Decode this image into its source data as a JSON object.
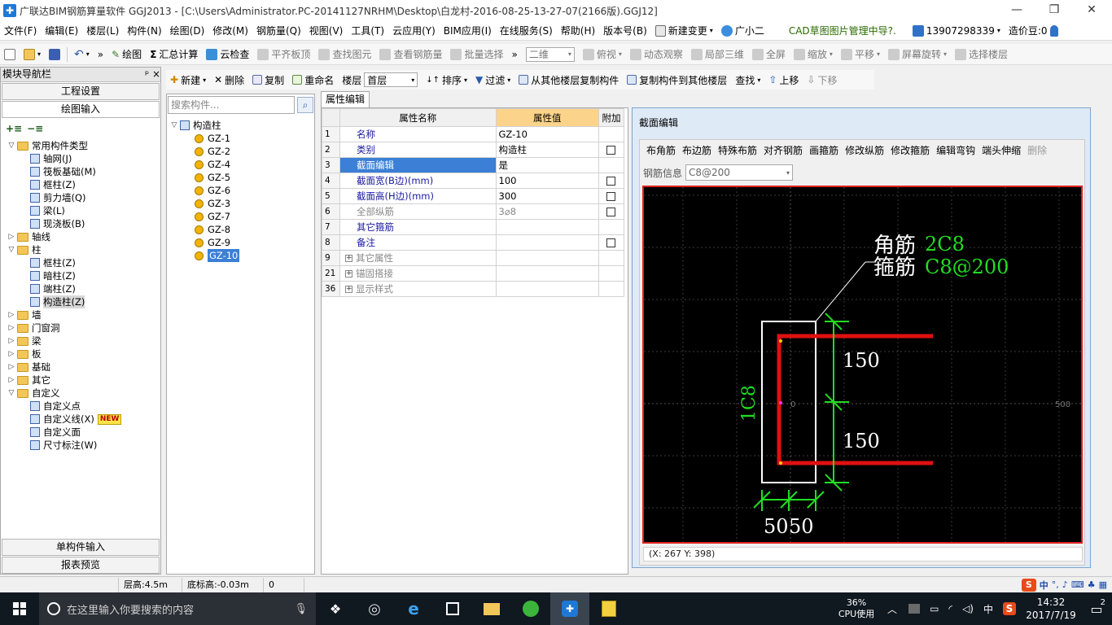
{
  "title": "广联达BIM钢筋算量软件 GGJ2013 - [C:\\Users\\Administrator.PC-20141127NRHM\\Desktop\\白龙村-2016-08-25-13-27-07(2166版).GGJ12]",
  "menu": [
    "文件(F)",
    "编辑(E)",
    "楼层(L)",
    "构件(N)",
    "绘图(D)",
    "修改(M)",
    "钢筋量(Q)",
    "视图(V)",
    "工具(T)",
    "云应用(Y)",
    "BIM应用(I)",
    "在线服务(S)",
    "帮助(H)",
    "版本号(B)"
  ],
  "menu_extra": {
    "new_change": "新建变更",
    "assistant": "广小二",
    "cad_manage": "CAD草图图片管理中导?.",
    "phone": "13907298339",
    "price_bean": "造价豆:0"
  },
  "toolbar1": {
    "draw": "绘图",
    "summary": "汇总计算",
    "cloud_check": "云检查",
    "align_slab": "平齐板顶",
    "find_element": "查找图元",
    "view_rebar": "查看钢筋量",
    "batch_select": "批量选择",
    "view_mode": "二维",
    "top_view": "俯视",
    "dynamic": "动态观察",
    "local_3d": "局部三维",
    "fullscreen": "全屏",
    "zoom": "缩放",
    "pan": "平移",
    "screen_rotate": "屏幕旋转",
    "select_floor": "选择楼层"
  },
  "nav": {
    "title": "模块导航栏",
    "pin": "ᵖ ×",
    "btn_project": "工程设置",
    "btn_draw": "绘图输入",
    "btn_single": "单构件输入",
    "btn_report": "报表预览",
    "tree": [
      {
        "level": 0,
        "exp": "▽",
        "type": "folder",
        "label": "常用构件类型"
      },
      {
        "level": 1,
        "type": "grid",
        "label": "轴网(J)"
      },
      {
        "level": 1,
        "type": "grid",
        "label": "筏板基础(M)"
      },
      {
        "level": 1,
        "type": "grid",
        "label": "框柱(Z)"
      },
      {
        "level": 1,
        "type": "grid",
        "label": "剪力墙(Q)"
      },
      {
        "level": 1,
        "type": "grid",
        "label": "梁(L)"
      },
      {
        "level": 1,
        "type": "grid",
        "label": "现浇板(B)"
      },
      {
        "level": 0,
        "exp": "▷",
        "type": "folder",
        "label": "轴线"
      },
      {
        "level": 0,
        "exp": "▽",
        "type": "folder",
        "label": "柱"
      },
      {
        "level": 1,
        "type": "grid",
        "label": "框柱(Z)"
      },
      {
        "level": 1,
        "type": "grid",
        "label": "暗柱(Z)"
      },
      {
        "level": 1,
        "type": "grid",
        "label": "端柱(Z)"
      },
      {
        "level": 1,
        "type": "grid",
        "label": "构造柱(Z)",
        "sel": true
      },
      {
        "level": 0,
        "exp": "▷",
        "type": "folder",
        "label": "墙"
      },
      {
        "level": 0,
        "exp": "▷",
        "type": "folder",
        "label": "门窗洞"
      },
      {
        "level": 0,
        "exp": "▷",
        "type": "folder",
        "label": "梁"
      },
      {
        "level": 0,
        "exp": "▷",
        "type": "folder",
        "label": "板"
      },
      {
        "level": 0,
        "exp": "▷",
        "type": "folder",
        "label": "基础"
      },
      {
        "level": 0,
        "exp": "▷",
        "type": "folder",
        "label": "其它"
      },
      {
        "level": 0,
        "exp": "▽",
        "type": "folder",
        "label": "自定义"
      },
      {
        "level": 1,
        "type": "grid",
        "label": "自定义点"
      },
      {
        "level": 1,
        "type": "grid",
        "label": "自定义线(X)",
        "badge": "NEW"
      },
      {
        "level": 1,
        "type": "grid",
        "label": "自定义面"
      },
      {
        "level": 1,
        "type": "grid",
        "label": "尺寸标注(W)"
      }
    ]
  },
  "toolbar2": {
    "new": "新建",
    "delete": "删除",
    "copy": "复制",
    "rename": "重命名",
    "floor_label": "楼层",
    "floor_value": "首层",
    "sort": "排序",
    "filter": "过滤",
    "copy_from": "从其他楼层复制构件",
    "copy_to": "复制构件到其他楼层",
    "find": "查找",
    "move_up": "上移",
    "move_down": "下移"
  },
  "components": {
    "search_placeholder": "搜索构件...",
    "root": "构造柱",
    "items": [
      "GZ-1",
      "GZ-2",
      "GZ-4",
      "GZ-5",
      "GZ-6",
      "GZ-3",
      "GZ-7",
      "GZ-8",
      "GZ-9",
      "GZ-10"
    ],
    "selected": "GZ-10"
  },
  "props": {
    "tab": "属性编辑",
    "col_name": "属性名称",
    "col_value": "属性值",
    "col_extra": "附加",
    "rows": [
      {
        "no": "1",
        "name": "名称",
        "value": "GZ-10",
        "chk": false,
        "cls": ""
      },
      {
        "no": "2",
        "name": "类别",
        "value": "构造柱",
        "chk": true,
        "cls": ""
      },
      {
        "no": "3",
        "name": "截面编辑",
        "value": "是",
        "chk": false,
        "cls": "selrow"
      },
      {
        "no": "4",
        "name": "截面宽(B边)(mm)",
        "value": "100",
        "chk": true,
        "cls": ""
      },
      {
        "no": "5",
        "name": "截面高(H边)(mm)",
        "value": "300",
        "chk": true,
        "cls": ""
      },
      {
        "no": "6",
        "name": "全部纵筋",
        "value": "3⌀8",
        "chk": true,
        "cls": "gray"
      },
      {
        "no": "7",
        "name": "其它箍筋",
        "value": "",
        "chk": false,
        "cls": ""
      },
      {
        "no": "8",
        "name": "备注",
        "value": "",
        "chk": true,
        "cls": ""
      },
      {
        "no": "9",
        "name": "其它属性",
        "value": "",
        "chk": false,
        "cls": "gray",
        "plus": true
      },
      {
        "no": "21",
        "name": "锚固搭接",
        "value": "",
        "chk": false,
        "cls": "gray",
        "plus": true
      },
      {
        "no": "36",
        "name": "显示样式",
        "value": "",
        "chk": false,
        "cls": "gray",
        "plus": true
      }
    ]
  },
  "section": {
    "title": "截面编辑",
    "tools": [
      "布角筋",
      "布边筋",
      "特殊布筋",
      "对齐钢筋",
      "画箍筋",
      "修改纵筋",
      "修改箍筋",
      "编辑弯钩",
      "端头伸缩",
      "删除"
    ],
    "rebar_info_label": "钢筋信息",
    "rebar_info_value": "C8@200",
    "corner_label": "角筋",
    "corner_value": "2C8",
    "stirrup_label": "箍筋",
    "stirrup_value": "C8@200",
    "dim_h1": "150",
    "dim_h2": "150",
    "dim_w1": "50",
    "dim_w2": "50",
    "left_label": "1C8",
    "origin": "0",
    "axis_500": "500",
    "coord": "(X: 267 Y: 398)"
  },
  "status": {
    "floor_h": "层高:4.5m",
    "base_h": "底标高:-0.03m",
    "val": "0"
  },
  "taskbar": {
    "search": "在这里输入你要搜索的内容",
    "cpu_pct": "36%",
    "cpu_label": "CPU使用",
    "ime": "中",
    "time": "14:32",
    "date": "2017/7/19",
    "notif": "2"
  },
  "colors": {
    "accent": "#3b7fd6",
    "rebar": "#e01010",
    "dim": "#22dd22",
    "canvas": "#000000"
  }
}
